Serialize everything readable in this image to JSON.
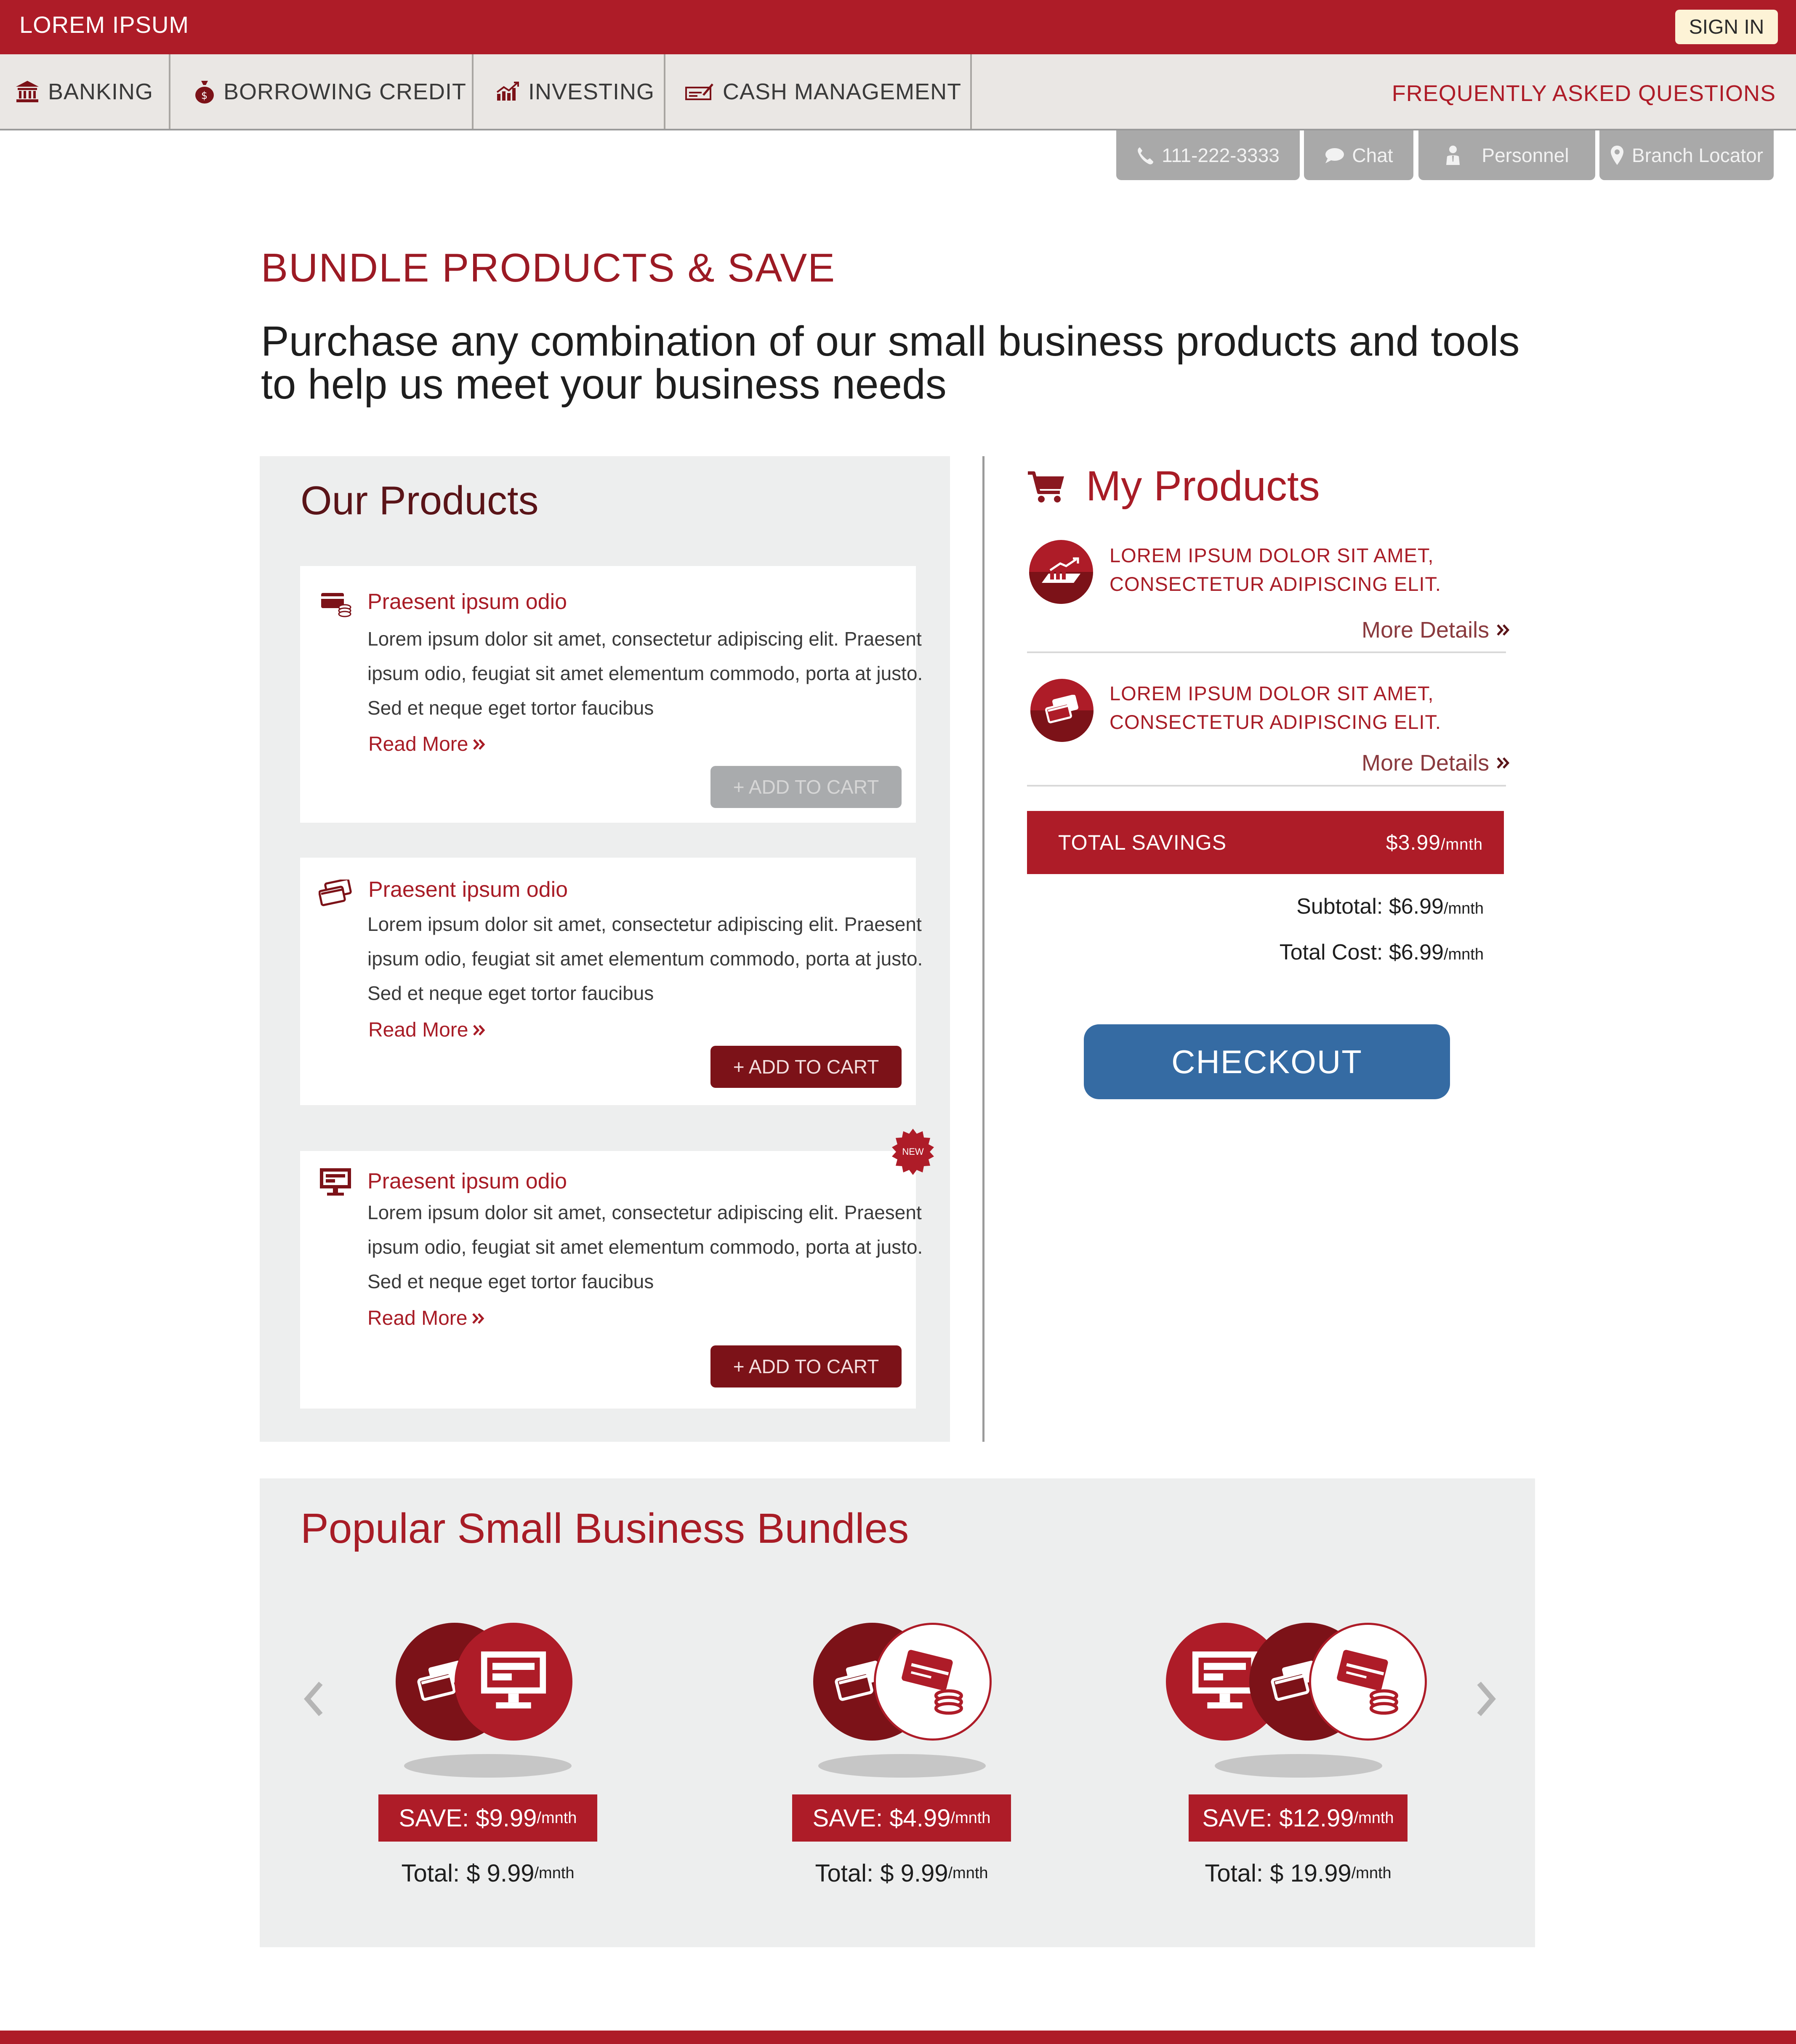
{
  "header": {
    "brand": "LOREM IPSUM",
    "signin": "SIGN IN"
  },
  "nav": {
    "items": [
      {
        "label": "BANKING",
        "icon": "bank-icon"
      },
      {
        "label": "BORROWING CREDIT",
        "icon": "money-bag-icon"
      },
      {
        "label": "INVESTING",
        "icon": "chart-icon"
      },
      {
        "label": "CASH MANAGEMENT",
        "icon": "check-icon"
      }
    ],
    "faq": "FREQUENTLY ASKED QUESTIONS"
  },
  "contact": {
    "phone": "111-222-3333",
    "chat": "Chat",
    "personnel": "Personnel",
    "branch": "Branch Locator"
  },
  "page": {
    "title": "BUNDLE PRODUCTS & SAVE",
    "subtitle": "Purchase any combination of our small business products and tools to help us meet your business needs"
  },
  "our_products": {
    "title": "Our Products",
    "new_badge": "NEW",
    "cards": [
      {
        "title": "Praesent ipsum odio",
        "text": "Lorem ipsum dolor sit amet, consectetur adipiscing elit. Praesent ipsum odio, feugiat sit amet elementum commodo, porta at justo. Sed et neque eget tortor faucibus",
        "read_more": "Read More",
        "button": "+ ADD TO CART",
        "icon": "card-coins-icon"
      },
      {
        "title": "Praesent ipsum odio",
        "text": "Lorem ipsum dolor sit amet, consectetur adipiscing elit. Praesent ipsum odio, feugiat sit amet elementum commodo, porta at justo. Sed et neque eget tortor faucibus",
        "read_more": "Read More",
        "button": "+ ADD TO CART",
        "icon": "credit-cards-icon"
      },
      {
        "title": "Praesent ipsum odio",
        "text": "Lorem ipsum dolor sit amet, consectetur adipiscing elit. Praesent ipsum odio, feugiat sit amet elementum commodo, porta at justo. Sed et neque eget tortor faucibus",
        "read_more": "Read More",
        "button": "+ ADD TO CART",
        "icon": "monitor-icon"
      }
    ]
  },
  "my_products": {
    "title": "My Products",
    "items": [
      {
        "line1": "LOREM IPSUM DOLOR SIT AMET,",
        "line2": "CONSECTETUR ADIPISCING ELIT.",
        "more": "More Details",
        "icon": "investing-chart-icon"
      },
      {
        "line1": "LOREM IPSUM DOLOR SIT AMET,",
        "line2": "CONSECTETUR ADIPISCING ELIT.",
        "more": "More Details",
        "icon": "credit-cards-icon"
      }
    ],
    "savings_label": "TOTAL SAVINGS",
    "savings_value": "$3.99",
    "per_month": "/mnth",
    "subtotal_label": "Subtotal:",
    "subtotal_value": "$6.99",
    "totalcost_label": "Total Cost:",
    "totalcost_value": "$6.99",
    "checkout": "CHECKOUT"
  },
  "bundles": {
    "title": "Popular Small Business Bundles",
    "items": [
      {
        "save_label": "SAVE:",
        "save_value": "$9.99",
        "total_label": "Total:",
        "total_value": "$ 9.99",
        "per": "/mnth"
      },
      {
        "save_label": "SAVE:",
        "save_value": "$4.99",
        "total_label": "Total:",
        "total_value": "$ 9.99",
        "per": "/mnth"
      },
      {
        "save_label": "SAVE:",
        "save_value": "$12.99",
        "total_label": "Total:",
        "total_value": "$ 19.99",
        "per": "/mnth"
      }
    ]
  },
  "colors": {
    "brand_red": "#ae1c28",
    "dark_red": "#7c1218",
    "checkout_blue": "#356ba3",
    "panel_gray": "#edeeee"
  }
}
